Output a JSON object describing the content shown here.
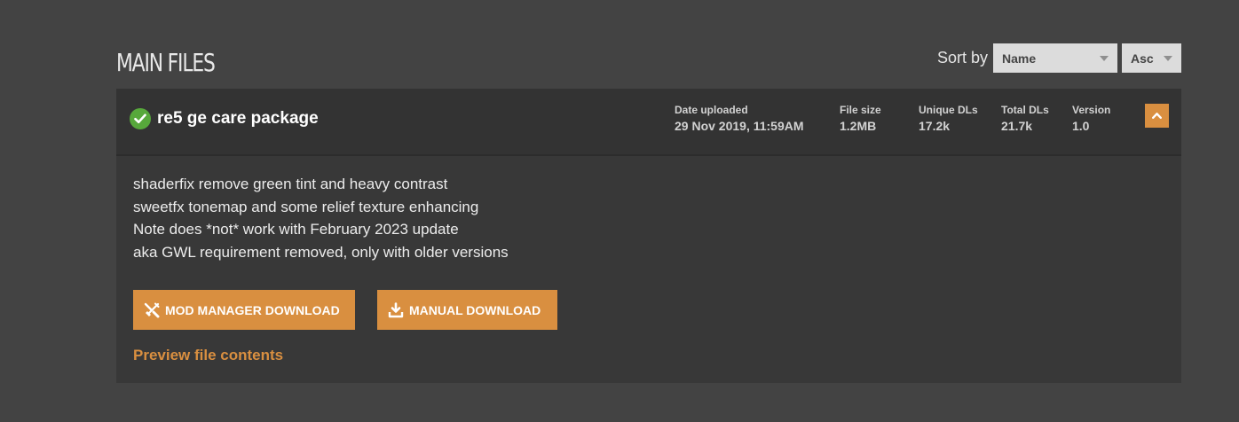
{
  "section": {
    "title": "MAIN FILES"
  },
  "sort": {
    "label": "Sort by",
    "field_value": "Name",
    "order_value": "Asc"
  },
  "file": {
    "name": "re5 ge care package",
    "status_icon": "check-circle-icon",
    "stats": {
      "date": {
        "label": "Date uploaded",
        "value": "29 Nov 2019, 11:59AM"
      },
      "size": {
        "label": "File size",
        "value": "1.2MB"
      },
      "unique": {
        "label": "Unique DLs",
        "value": "17.2k"
      },
      "total": {
        "label": "Total DLs",
        "value": "21.7k"
      },
      "version": {
        "label": "Version",
        "value": "1.0"
      }
    },
    "description": [
      "shaderfix remove green tint and heavy contrast",
      "sweetfx tonemap and some relief texture enhancing",
      "Note does *not* work with February 2023 update",
      "aka GWL requirement removed, only with older versions"
    ],
    "buttons": {
      "mod_manager": "MOD MANAGER DOWNLOAD",
      "manual": "MANUAL DOWNLOAD"
    },
    "preview_link": "Preview file contents"
  },
  "colors": {
    "background": "#434343",
    "card": "#383838",
    "header": "#333333",
    "accent": "#d98f40",
    "check": "#57a83b"
  }
}
